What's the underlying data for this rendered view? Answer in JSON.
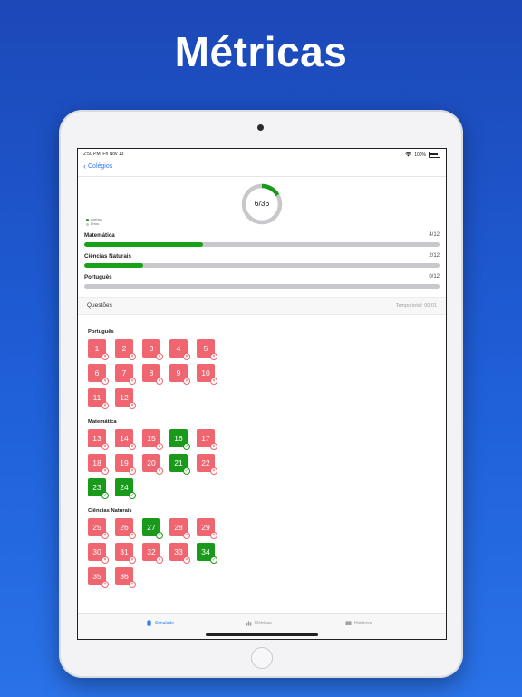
{
  "headline": "Métricas",
  "status": {
    "time": "2:50 PM",
    "date": "Fri Nov 13",
    "battery": "100%"
  },
  "nav": {
    "back_label": "Colégios"
  },
  "summary": {
    "score": "6/36",
    "correct_fraction": 0.1667
  },
  "legend": {
    "correct": "Acertos",
    "wrong": "Erros"
  },
  "colors": {
    "correct": "#1a9a1a",
    "wrong": "#ef6670",
    "accent": "#2f7cf6",
    "track": "#c7c7cc"
  },
  "subjects": [
    {
      "name": "Matemática",
      "count": "4/12",
      "fraction": 0.3333
    },
    {
      "name": "Ciências Naturais",
      "count": "2/12",
      "fraction": 0.1667
    },
    {
      "name": "Português",
      "count": "0/12",
      "fraction": 0
    }
  ],
  "questions_section": {
    "title": "Questões",
    "total_time": "Tempo total: 00:01"
  },
  "question_groups": [
    {
      "title": "Português",
      "items": [
        {
          "n": "1",
          "ok": false
        },
        {
          "n": "2",
          "ok": false
        },
        {
          "n": "3",
          "ok": false
        },
        {
          "n": "4",
          "ok": false
        },
        {
          "n": "5",
          "ok": false
        },
        {
          "n": "6",
          "ok": false
        },
        {
          "n": "7",
          "ok": false
        },
        {
          "n": "8",
          "ok": false
        },
        {
          "n": "9",
          "ok": false
        },
        {
          "n": "10",
          "ok": false
        },
        {
          "n": "11",
          "ok": false
        },
        {
          "n": "12",
          "ok": false
        }
      ]
    },
    {
      "title": "Matemática",
      "items": [
        {
          "n": "13",
          "ok": false
        },
        {
          "n": "14",
          "ok": false
        },
        {
          "n": "15",
          "ok": false
        },
        {
          "n": "16",
          "ok": true
        },
        {
          "n": "17",
          "ok": false
        },
        {
          "n": "18",
          "ok": false
        },
        {
          "n": "19",
          "ok": false
        },
        {
          "n": "20",
          "ok": false
        },
        {
          "n": "21",
          "ok": true
        },
        {
          "n": "22",
          "ok": false
        },
        {
          "n": "23",
          "ok": true
        },
        {
          "n": "24",
          "ok": true
        }
      ]
    },
    {
      "title": "Ciências Naturais",
      "items": [
        {
          "n": "25",
          "ok": false
        },
        {
          "n": "26",
          "ok": false
        },
        {
          "n": "27",
          "ok": true
        },
        {
          "n": "28",
          "ok": false
        },
        {
          "n": "29",
          "ok": false
        },
        {
          "n": "30",
          "ok": false
        },
        {
          "n": "31",
          "ok": false
        },
        {
          "n": "32",
          "ok": false
        },
        {
          "n": "33",
          "ok": false
        },
        {
          "n": "34",
          "ok": true
        },
        {
          "n": "35",
          "ok": false
        },
        {
          "n": "36",
          "ok": false
        }
      ]
    }
  ],
  "tabs": [
    {
      "label": "Simulado",
      "icon": "clipboard-icon",
      "active": true
    },
    {
      "label": "Métricas",
      "icon": "bar-chart-icon",
      "active": false
    },
    {
      "label": "Histórico",
      "icon": "book-icon",
      "active": false
    }
  ]
}
